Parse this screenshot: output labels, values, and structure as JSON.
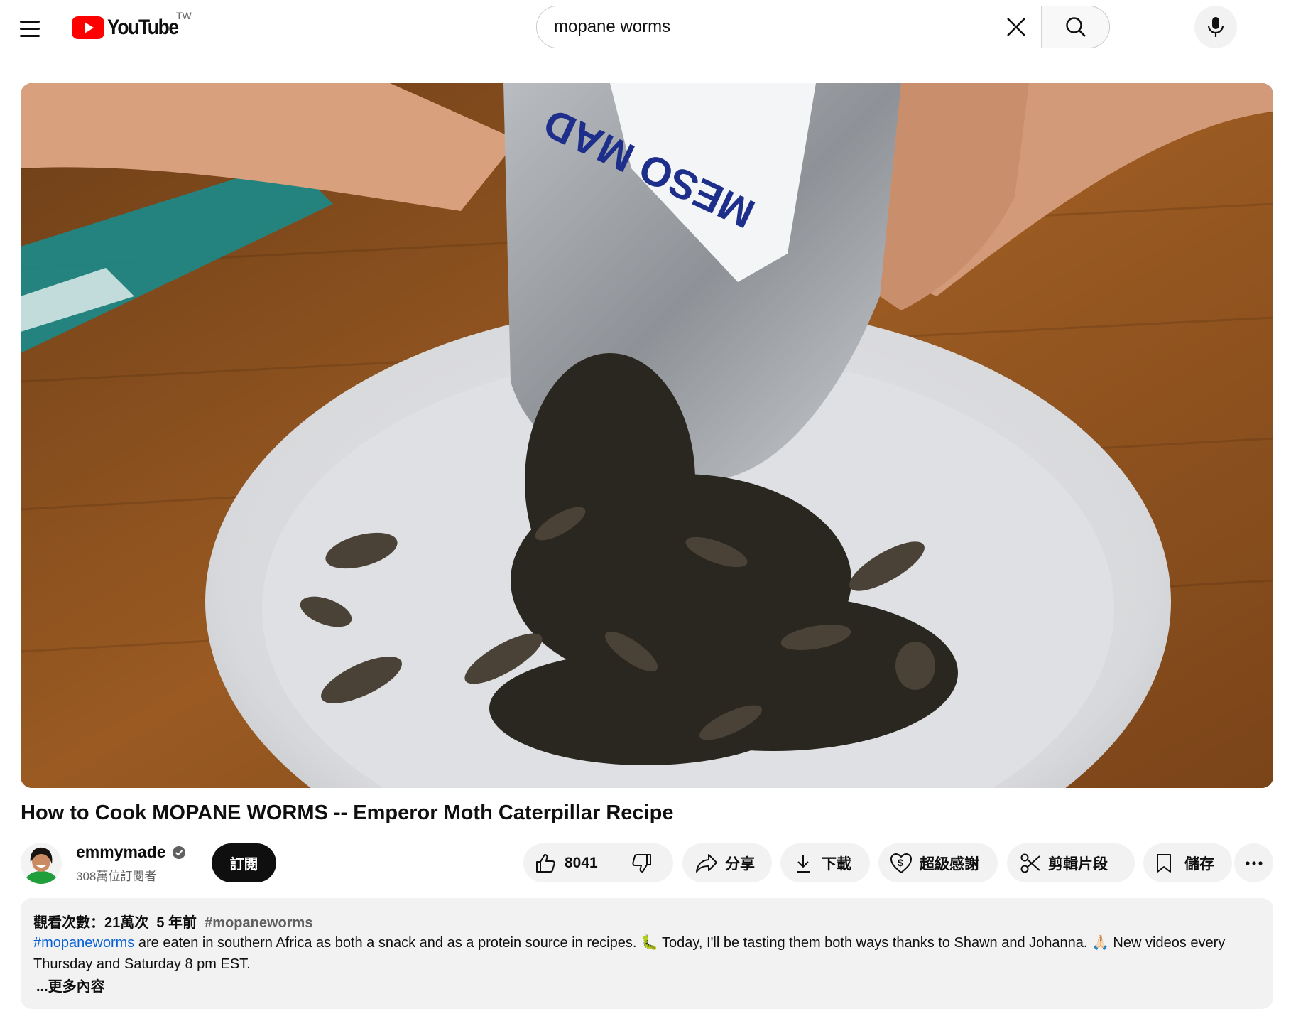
{
  "header": {
    "logo_text": "YouTube",
    "country_code": "TW",
    "search_value": "mopane worms"
  },
  "video": {
    "title": "How to Cook MOPANE WORMS -- Emperor Moth Caterpillar Recipe",
    "package_text": "MESO MAD"
  },
  "channel": {
    "name": "emmymade",
    "subscribers": "308萬位訂閱者",
    "subscribe_label": "訂閱"
  },
  "actions": {
    "like_count": "8041",
    "share_label": "分享",
    "download_label": "下載",
    "thanks_label": "超級感謝",
    "clip_label": "剪輯片段",
    "save_label": "儲存"
  },
  "description": {
    "views": "觀看次數：21萬次",
    "date": "5 年前",
    "hashtag": "#mopaneworms",
    "text_link": "#mopaneworms",
    "text_1": " are eaten in southern Africa as both a snack and as a protein source in recipes. 🐛 Today, I'll be tasting them both ways thanks to Shawn and Johanna.  🙏🏻 New videos every Thursday and Saturday 8 pm EST.",
    "more_label": "...更多內容"
  },
  "colors": {
    "brand_red": "#ff0000",
    "link_blue": "#065fd4",
    "pill_bg": "#f2f2f2"
  }
}
